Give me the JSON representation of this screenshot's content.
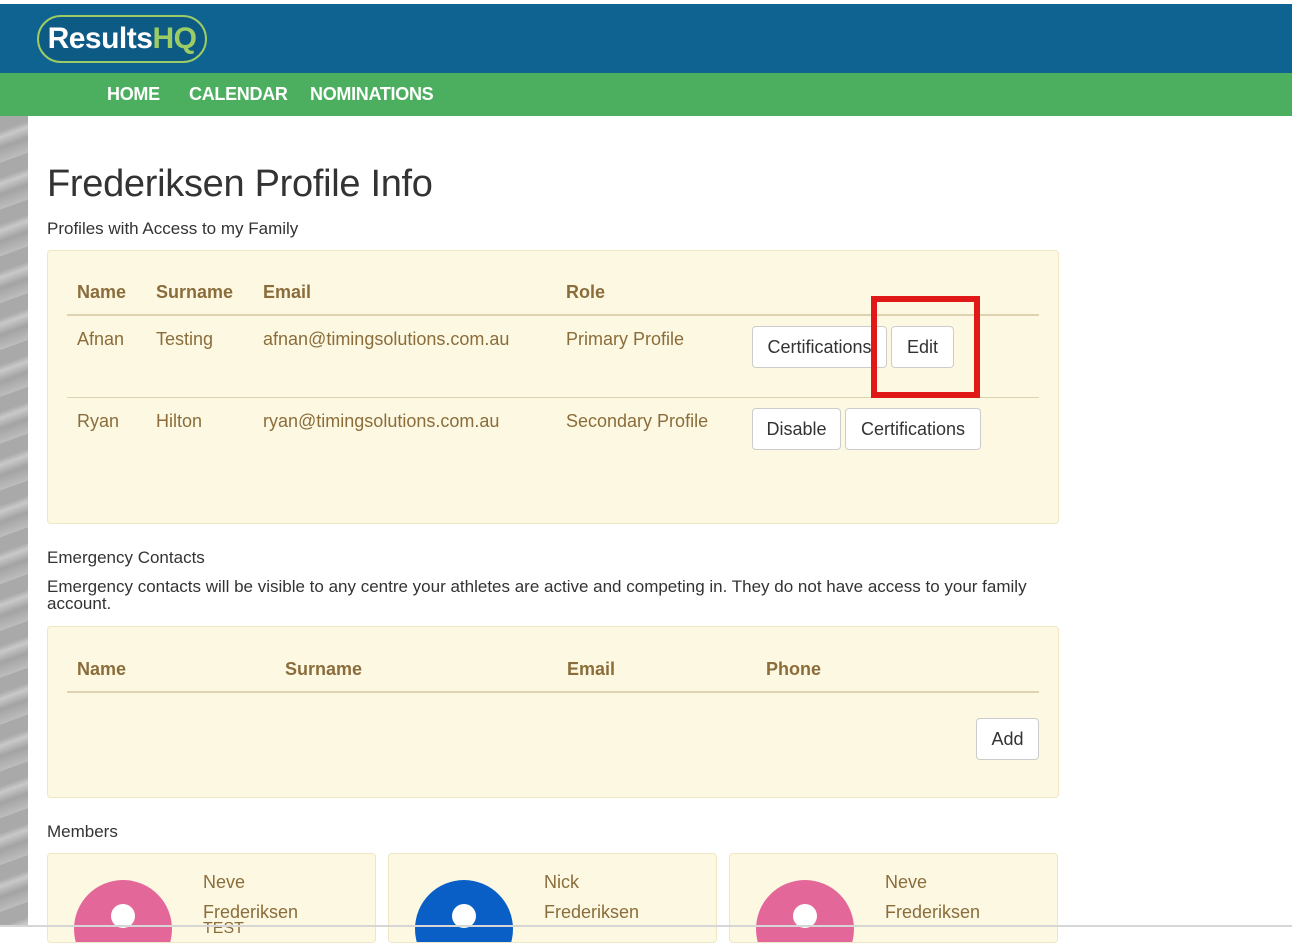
{
  "header": {
    "logo_text_a": "Results",
    "logo_text_b": "HQ",
    "nav": [
      "HOME",
      "CALENDAR",
      "NOMINATIONS"
    ]
  },
  "page": {
    "title": "Frederiksen Profile Info",
    "profiles_label": "Profiles with Access to my Family"
  },
  "profiles_table": {
    "headers": [
      "Name",
      "Surname",
      "Email",
      "Role"
    ],
    "rows": [
      {
        "name": "Afnan",
        "surname": "Testing",
        "email": "afnan@timingsolutions.com.au",
        "role": "Primary Profile",
        "buttons": [
          "Certifications",
          "Edit"
        ]
      },
      {
        "name": "Ryan",
        "surname": "Hilton",
        "email": "ryan@timingsolutions.com.au",
        "role": "Secondary Profile",
        "buttons": [
          "Disable",
          "Certifications"
        ]
      }
    ]
  },
  "emergency": {
    "label": "Emergency Contacts",
    "description": "Emergency contacts will be visible to any centre your athletes are active and competing in. They do not have access to your family account.",
    "headers": [
      "Name",
      "Surname",
      "Email",
      "Phone"
    ],
    "add_label": "Add"
  },
  "members": {
    "label": "Members",
    "cards": [
      {
        "first": "Neve",
        "last": "Frederiksen",
        "extra": "TEST",
        "avatar_color": "#e4679a"
      },
      {
        "first": "Nick",
        "last": "Frederiksen",
        "extra": "",
        "avatar_color": "#0a5fc7"
      },
      {
        "first": "Neve",
        "last": "Frederiksen",
        "extra": "",
        "avatar_color": "#e4679a"
      }
    ]
  },
  "colors": {
    "topbar": "#0f6390",
    "navbar": "#4caf5f",
    "panel": "#fdf8e2",
    "table_text": "#8a6d3b",
    "highlight": "#e01818"
  }
}
